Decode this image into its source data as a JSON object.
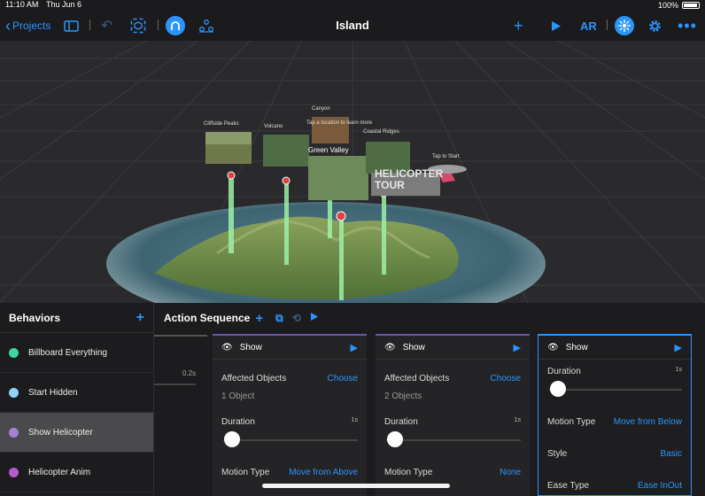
{
  "status": {
    "time": "11:10 AM",
    "date": "Thu Jun 6",
    "battery": "100%"
  },
  "toolbar": {
    "back_label": "Projects",
    "title": "Island",
    "ar_label": "AR"
  },
  "scene": {
    "labels": [
      "Cliffside Peaks",
      "Volcano",
      "Canyon",
      "Tap a location to learn more",
      "Coastal Ridges",
      "Green Valley",
      "Tap to Start"
    ],
    "helicopter_title": "HELICOPTER\nTOUR"
  },
  "behaviors": {
    "title": "Behaviors",
    "items": [
      {
        "label": "Billboard Everything",
        "color": "#3dd6a0"
      },
      {
        "label": "Start Hidden",
        "color": "#8ed3f5"
      },
      {
        "label": "Show Helicopter",
        "color": "#a67fd6"
      },
      {
        "label": "Helicopter Anim",
        "color": "#b75ad0"
      }
    ]
  },
  "sequence": {
    "title": "Action Sequence",
    "track_time": "0.2s",
    "cards": [
      {
        "title": "Show",
        "affected_label": "Affected Objects",
        "choose_label": "Choose",
        "objects": "1 Object",
        "duration_label": "Duration",
        "duration_value": "1s",
        "duration_fraction": 0,
        "motion_label": "Motion Type",
        "motion_value": "Move from Above"
      },
      {
        "title": "Show",
        "affected_label": "Affected Objects",
        "choose_label": "Choose",
        "objects": "2 Objects",
        "duration_label": "Duration",
        "duration_value": "1s",
        "duration_fraction": 0,
        "motion_label": "Motion Type",
        "motion_value": "None"
      },
      {
        "title": "Show",
        "duration_label": "Duration",
        "duration_value": "1s",
        "duration_fraction": 0,
        "motion_label": "Motion Type",
        "motion_value": "Move from Below",
        "style_label": "Style",
        "style_value": "Basic",
        "ease_label": "Ease Type",
        "ease_value": "Ease InOut"
      }
    ]
  },
  "colors": {
    "accent": "#2b95ff",
    "selected": "#4a4a4c"
  }
}
